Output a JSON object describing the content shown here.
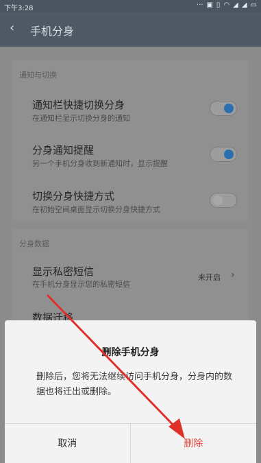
{
  "status": {
    "time": "下午3:28",
    "icons": [
      "dots-icon",
      "sim-icon",
      "vibrate-icon",
      "wifi-icon",
      "signal-icon",
      "signal-icon",
      "battery-icon"
    ]
  },
  "header": {
    "title": "手机分身",
    "back_icon": "back-chevron-icon"
  },
  "sections": {
    "notify": {
      "label": "通知与切换",
      "items": [
        {
          "title": "通知栏快捷切换分身",
          "subtitle": "在通知栏显示切换分身的通知",
          "toggle": "on"
        },
        {
          "title": "分身通知提醒",
          "subtitle": "另一个手机分身收到新通知时，显示提醒",
          "toggle": "on"
        },
        {
          "title": "切换分身快捷方式",
          "subtitle": "在初始空间桌面显示切换分身快捷方式",
          "toggle": "off"
        }
      ]
    },
    "data": {
      "label": "分身数据",
      "items": [
        {
          "title": "显示私密短信",
          "subtitle": "在手机分身显示您的私密短信",
          "value": "未开启"
        },
        {
          "title": "数据迁移"
        }
      ]
    }
  },
  "dialog": {
    "title": "删除手机分身",
    "message": "删除后，您将无法继续访问手机分身，分身内的数据也将迁出或删除。",
    "cancel_label": "取消",
    "ok_label": "删除"
  },
  "annotation": {
    "arrow_color": "#e0302a",
    "description": "red arrow pointing to confirm button"
  }
}
